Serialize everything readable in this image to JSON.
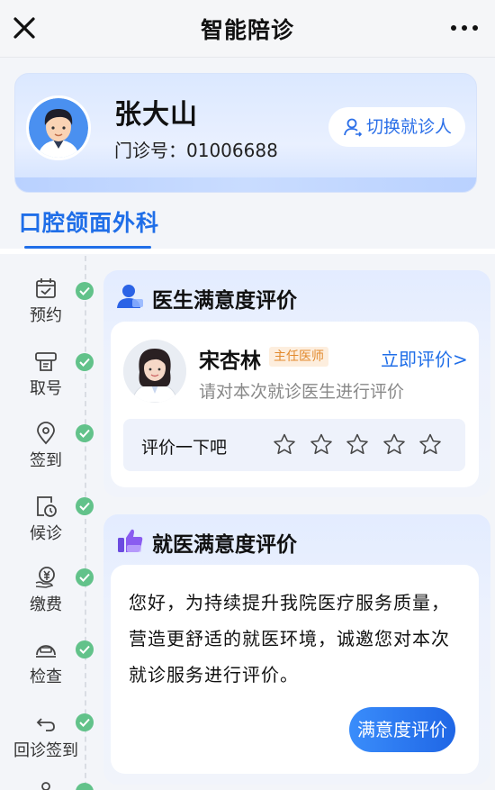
{
  "header": {
    "title": "智能陪诊"
  },
  "patient": {
    "name": "张大山",
    "clinic_no": "门诊号：01006688",
    "switch_label": "切换就诊人"
  },
  "department": {
    "tab": "口腔颌面外科"
  },
  "timeline": [
    {
      "label": "预约",
      "icon": "calendar-check-icon",
      "done": true
    },
    {
      "label": "取号",
      "icon": "ticket-printer-icon",
      "done": true
    },
    {
      "label": "签到",
      "icon": "location-pin-icon",
      "done": true
    },
    {
      "label": "候诊",
      "icon": "clock-document-icon",
      "done": true
    },
    {
      "label": "缴费",
      "icon": "yuan-payment-icon",
      "done": true
    },
    {
      "label": "检查",
      "icon": "scanner-icon",
      "done": true
    },
    {
      "label": "回诊签到",
      "icon": "return-arrow-icon",
      "done": true
    }
  ],
  "doctor_section": {
    "title": "医生满意度评价",
    "doctor_name": "宋杏林",
    "doctor_title": "主任医师",
    "rate_link": "立即评价>",
    "hint": "请对本次就诊医生进行评价",
    "rate_prompt": "评价一下吧",
    "stars": 5,
    "rating": 0
  },
  "visit_section": {
    "title": "就医满意度评价",
    "text": "您好，为持续提升我院医疗服务质量，营造更舒适的就医环境，诚邀您对本次就诊服务进行评价。",
    "button": "满意度评价"
  },
  "colors": {
    "accent": "#1f6ee8",
    "done": "#62c28a",
    "tag_text": "#e28a2e"
  }
}
